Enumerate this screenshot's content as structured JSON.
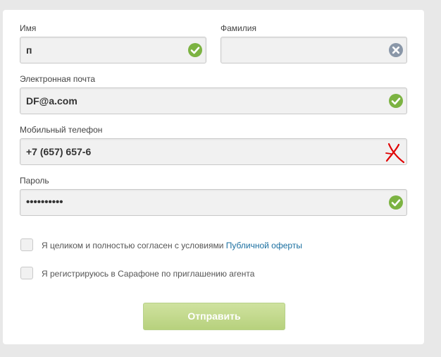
{
  "form": {
    "first_name": {
      "label": "Имя",
      "value": "п",
      "status": "valid",
      "status_icon": "check-icon"
    },
    "last_name": {
      "label": "Фамилия",
      "value": "",
      "status": "clear",
      "status_icon": "clear-icon"
    },
    "email": {
      "label": "Электронная почта",
      "value": "DF@a.com",
      "status": "valid",
      "status_icon": "check-icon"
    },
    "phone": {
      "label": "Мобильный телефон",
      "value": "+7 (657) 657-6",
      "status": "invalid",
      "status_icon": "red-x-mark-icon"
    },
    "password": {
      "label": "Пароль",
      "value": "••••••••••",
      "status": "valid",
      "status_icon": "check-icon"
    }
  },
  "agreements": {
    "offer": {
      "text": "Я целиком и полностью согласен с условиями ",
      "link_text": "Публичной оферты",
      "checked": false
    },
    "agent": {
      "text": "Я регистрируюсь в Сарафоне по приглашению агента",
      "checked": false
    }
  },
  "submit": {
    "label": "Отправить",
    "enabled": false
  },
  "colors": {
    "valid_green": "#7cb342",
    "clear_gray": "#8a97a8",
    "error_red": "#e00000",
    "link_blue": "#1a6fa0",
    "button_green": "#c3da8e"
  }
}
